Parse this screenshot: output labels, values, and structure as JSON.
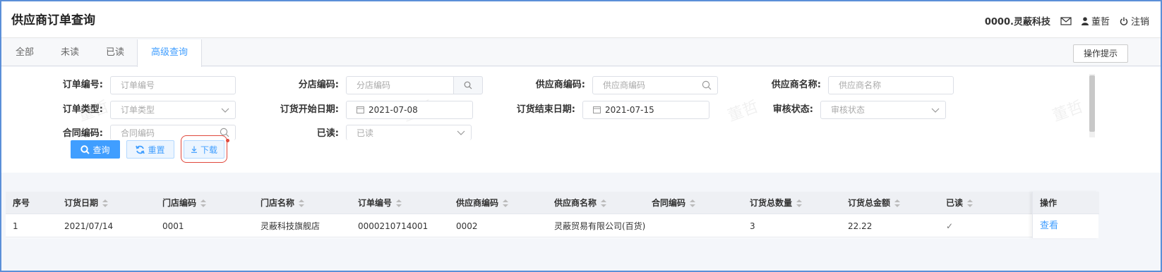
{
  "header": {
    "title": "供应商订单查询",
    "company": "0000.灵蔽科技",
    "user": "董哲",
    "logout": "注销"
  },
  "tabs": [
    {
      "label": "全部"
    },
    {
      "label": "未读"
    },
    {
      "label": "已读"
    },
    {
      "label": "高级查询",
      "active": true
    }
  ],
  "hint_button": "操作提示",
  "form": {
    "order_no": {
      "label": "订单编号:",
      "placeholder": "订单编号"
    },
    "store_code": {
      "label": "分店编码:",
      "placeholder": "分店编码"
    },
    "supplier_code": {
      "label": "供应商编码:",
      "placeholder": "供应商编码"
    },
    "supplier_name": {
      "label": "供应商名称:",
      "placeholder": "供应商名称"
    },
    "order_type": {
      "label": "订单类型:",
      "placeholder": "订单类型"
    },
    "start_date": {
      "label": "订货开始日期:",
      "value": "2021-07-08"
    },
    "end_date": {
      "label": "订货结束日期:",
      "value": "2021-07-15"
    },
    "audit_status": {
      "label": "审核状态:",
      "placeholder": "审核状态"
    },
    "contract_code": {
      "label": "合同编码:",
      "placeholder": "合同编码"
    },
    "read": {
      "label": "已读:",
      "value": "已读"
    }
  },
  "buttons": {
    "query": "查询",
    "reset": "重置",
    "download": "下载"
  },
  "watermark": "董哲",
  "table": {
    "columns": [
      "序号",
      "订货日期",
      "门店编码",
      "门店名称",
      "订单编号",
      "供应商编码",
      "供应商名称",
      "合同编码",
      "订货总数量",
      "订货总金额",
      "已读",
      "操作"
    ],
    "rows": [
      {
        "index": "1",
        "date": "2021/07/14",
        "store_code": "0001",
        "store_name": "灵蔽科技旗舰店",
        "order_no": "0000210714001",
        "supplier_code": "0002",
        "supplier_name": "灵蔽贸易有限公司(百货)",
        "contract_code": "",
        "total_qty": "3",
        "total_amount": "22.22",
        "read": "✓",
        "action": "查看"
      }
    ]
  },
  "colors": {
    "accent": "#409eff",
    "highlight": "#e0483c"
  }
}
